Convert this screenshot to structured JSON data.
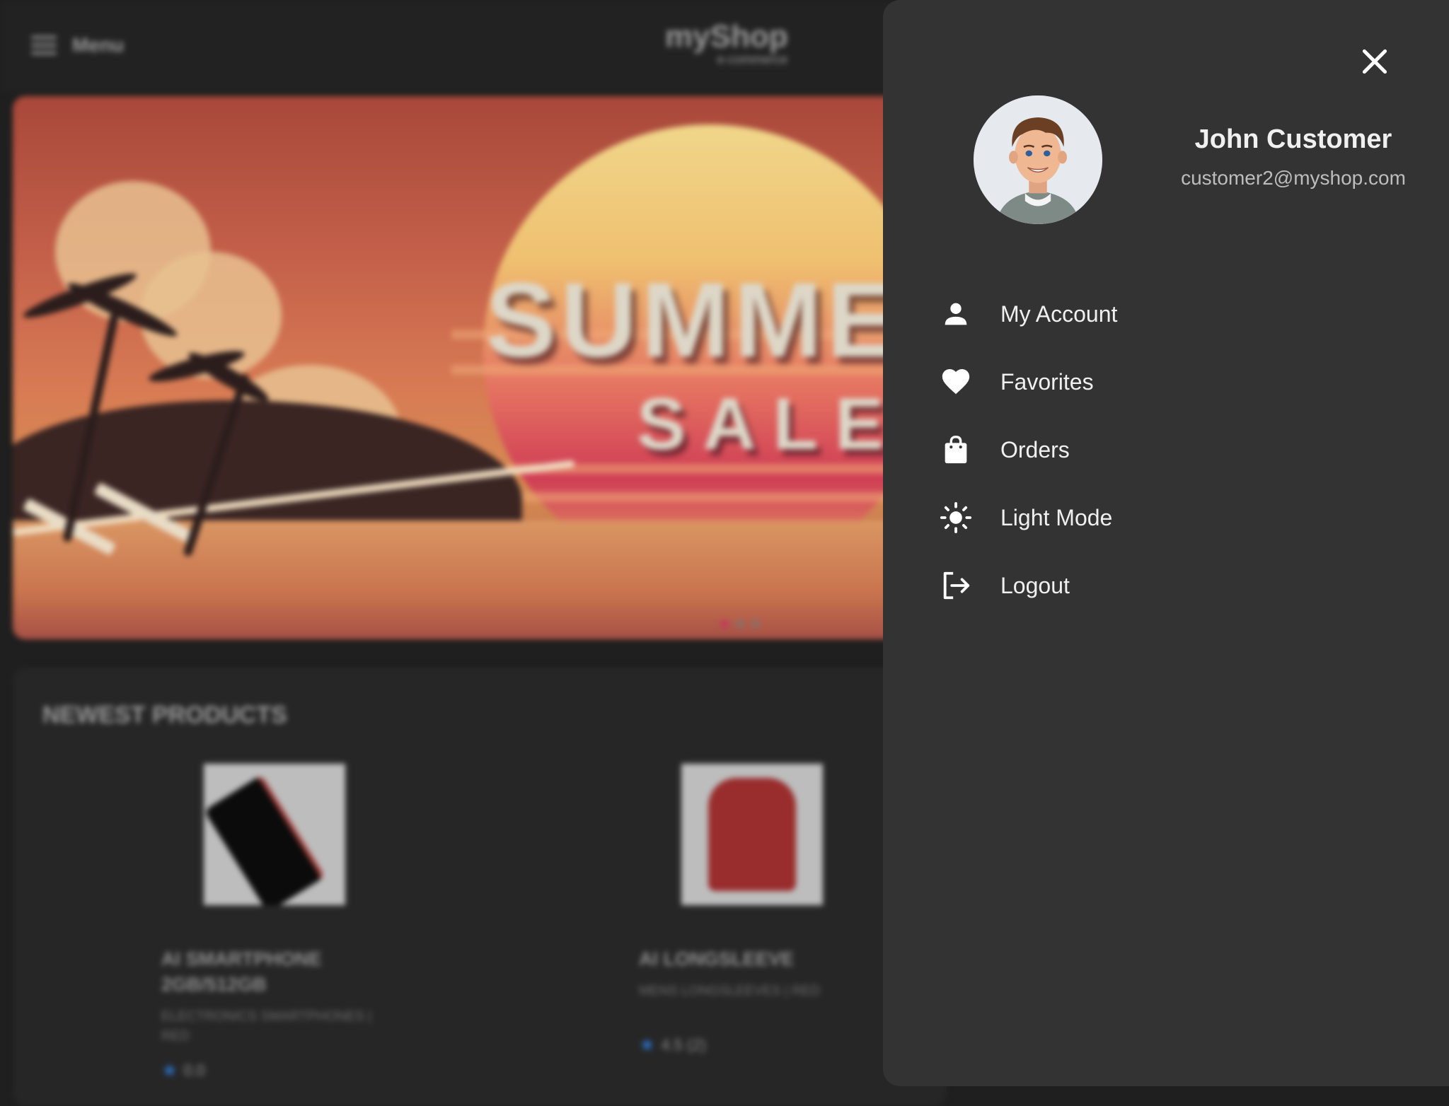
{
  "header": {
    "menu_label": "Menu",
    "brand_name": "myShop",
    "brand_tagline": "e-commerce"
  },
  "hero": {
    "title": "SUMME",
    "subtitle": "SALE",
    "slides_total": 3,
    "active_slide": 1
  },
  "products_section": {
    "title": "NEWEST PRODUCTS",
    "items": [
      {
        "name": "AI SMARTPHONE 2GB/512GB",
        "category": "ELECTRONICS SMARTPHONES | RED",
        "rating": "0.0"
      },
      {
        "name": "AI LONGSLEEVE",
        "category": "MENS LONGSLEEVES | RED",
        "rating": "4.5 (2)"
      }
    ]
  },
  "drawer": {
    "user": {
      "name": "John Customer",
      "email": "customer2@myshop.com"
    },
    "items": [
      {
        "label": "My Account",
        "icon": "person-icon"
      },
      {
        "label": "Favorites",
        "icon": "heart-icon"
      },
      {
        "label": "Orders",
        "icon": "shopping-bag-icon"
      },
      {
        "label": "Light Mode",
        "icon": "sun-icon"
      },
      {
        "label": "Logout",
        "icon": "logout-icon"
      }
    ]
  },
  "colors": {
    "page_bg": "#1f1f1f",
    "drawer_bg": "#333333",
    "text": "#f0f0f0",
    "muted_text": "#bdbdbd",
    "accent_dot": "#c23c5c",
    "rating_star": "#2c6fc2"
  }
}
